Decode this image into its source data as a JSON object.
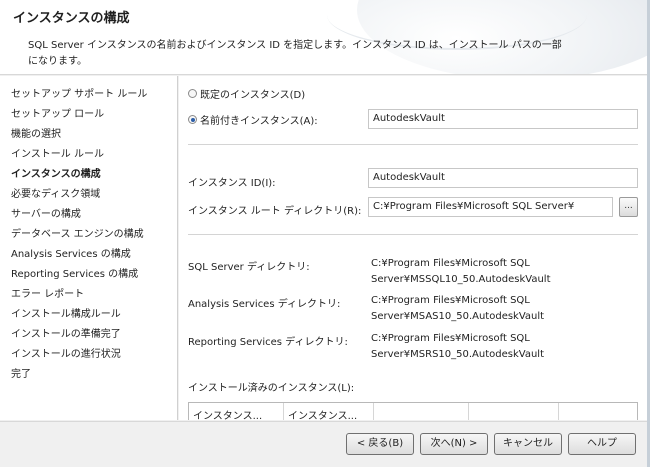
{
  "header": {
    "title": "インスタンスの構成",
    "description": "SQL Server インスタンスの名前およびインスタンス ID を指定します。インスタンス ID は、インストール パスの一部になります。"
  },
  "sidebar": {
    "items": [
      {
        "label": "セットアップ サポート ルール"
      },
      {
        "label": "セットアップ ロール"
      },
      {
        "label": "機能の選択"
      },
      {
        "label": "インストール ルール"
      },
      {
        "label": "インスタンスの構成"
      },
      {
        "label": "必要なディスク領域"
      },
      {
        "label": "サーバーの構成"
      },
      {
        "label": "データベース エンジンの構成"
      },
      {
        "label": "Analysis Services の構成"
      },
      {
        "label": "Reporting Services の構成"
      },
      {
        "label": "エラー レポート"
      },
      {
        "label": "インストール構成ルール"
      },
      {
        "label": "インストールの準備完了"
      },
      {
        "label": "インストールの進行状況"
      },
      {
        "label": "完了"
      }
    ],
    "active": "インスタンスの構成"
  },
  "main": {
    "default_instance_label": "既定のインスタンス(D)",
    "default_instance_checked": false,
    "named_instance_label": "名前付きインスタンス(A):",
    "named_instance_checked": true,
    "named_instance_value": "AutodeskVault",
    "instance_id_label": "インスタンス ID(I):",
    "instance_id_value": "AutodeskVault",
    "instance_root_label": "インスタンス ルート ディレクトリ(R):",
    "instance_root_value": "C:¥Program Files¥Microsoft SQL Server¥",
    "browse_label": "...",
    "sql_server_dir_label": "SQL Server ディレクトリ:",
    "sql_server_dir_value_1": "C:¥Program Files¥Microsoft SQL",
    "sql_server_dir_value_2": "Server¥MSSQL10_50.AutodeskVault",
    "analysis_dir_label": "Analysis Services ディレクトリ:",
    "analysis_dir_value_1": "C:¥Program Files¥Microsoft SQL",
    "analysis_dir_value_2": "Server¥MSAS10_50.AutodeskVault",
    "reporting_dir_label": "Reporting Services ディレクトリ:",
    "reporting_dir_value_1": "C:¥Program Files¥Microsoft SQL",
    "reporting_dir_value_2": "Server¥MSRS10_50.AutodeskVault",
    "installed_instances_label": "インストール済みのインスタンス(L):",
    "installed_grid_headers": [
      "インスタンス...",
      "インスタンス...",
      "",
      "",
      ""
    ]
  },
  "footer": {
    "back_label": "< 戻る(B)",
    "next_label": "次へ(N) >",
    "cancel_label": "キャンセル",
    "help_label": "ヘルプ"
  }
}
